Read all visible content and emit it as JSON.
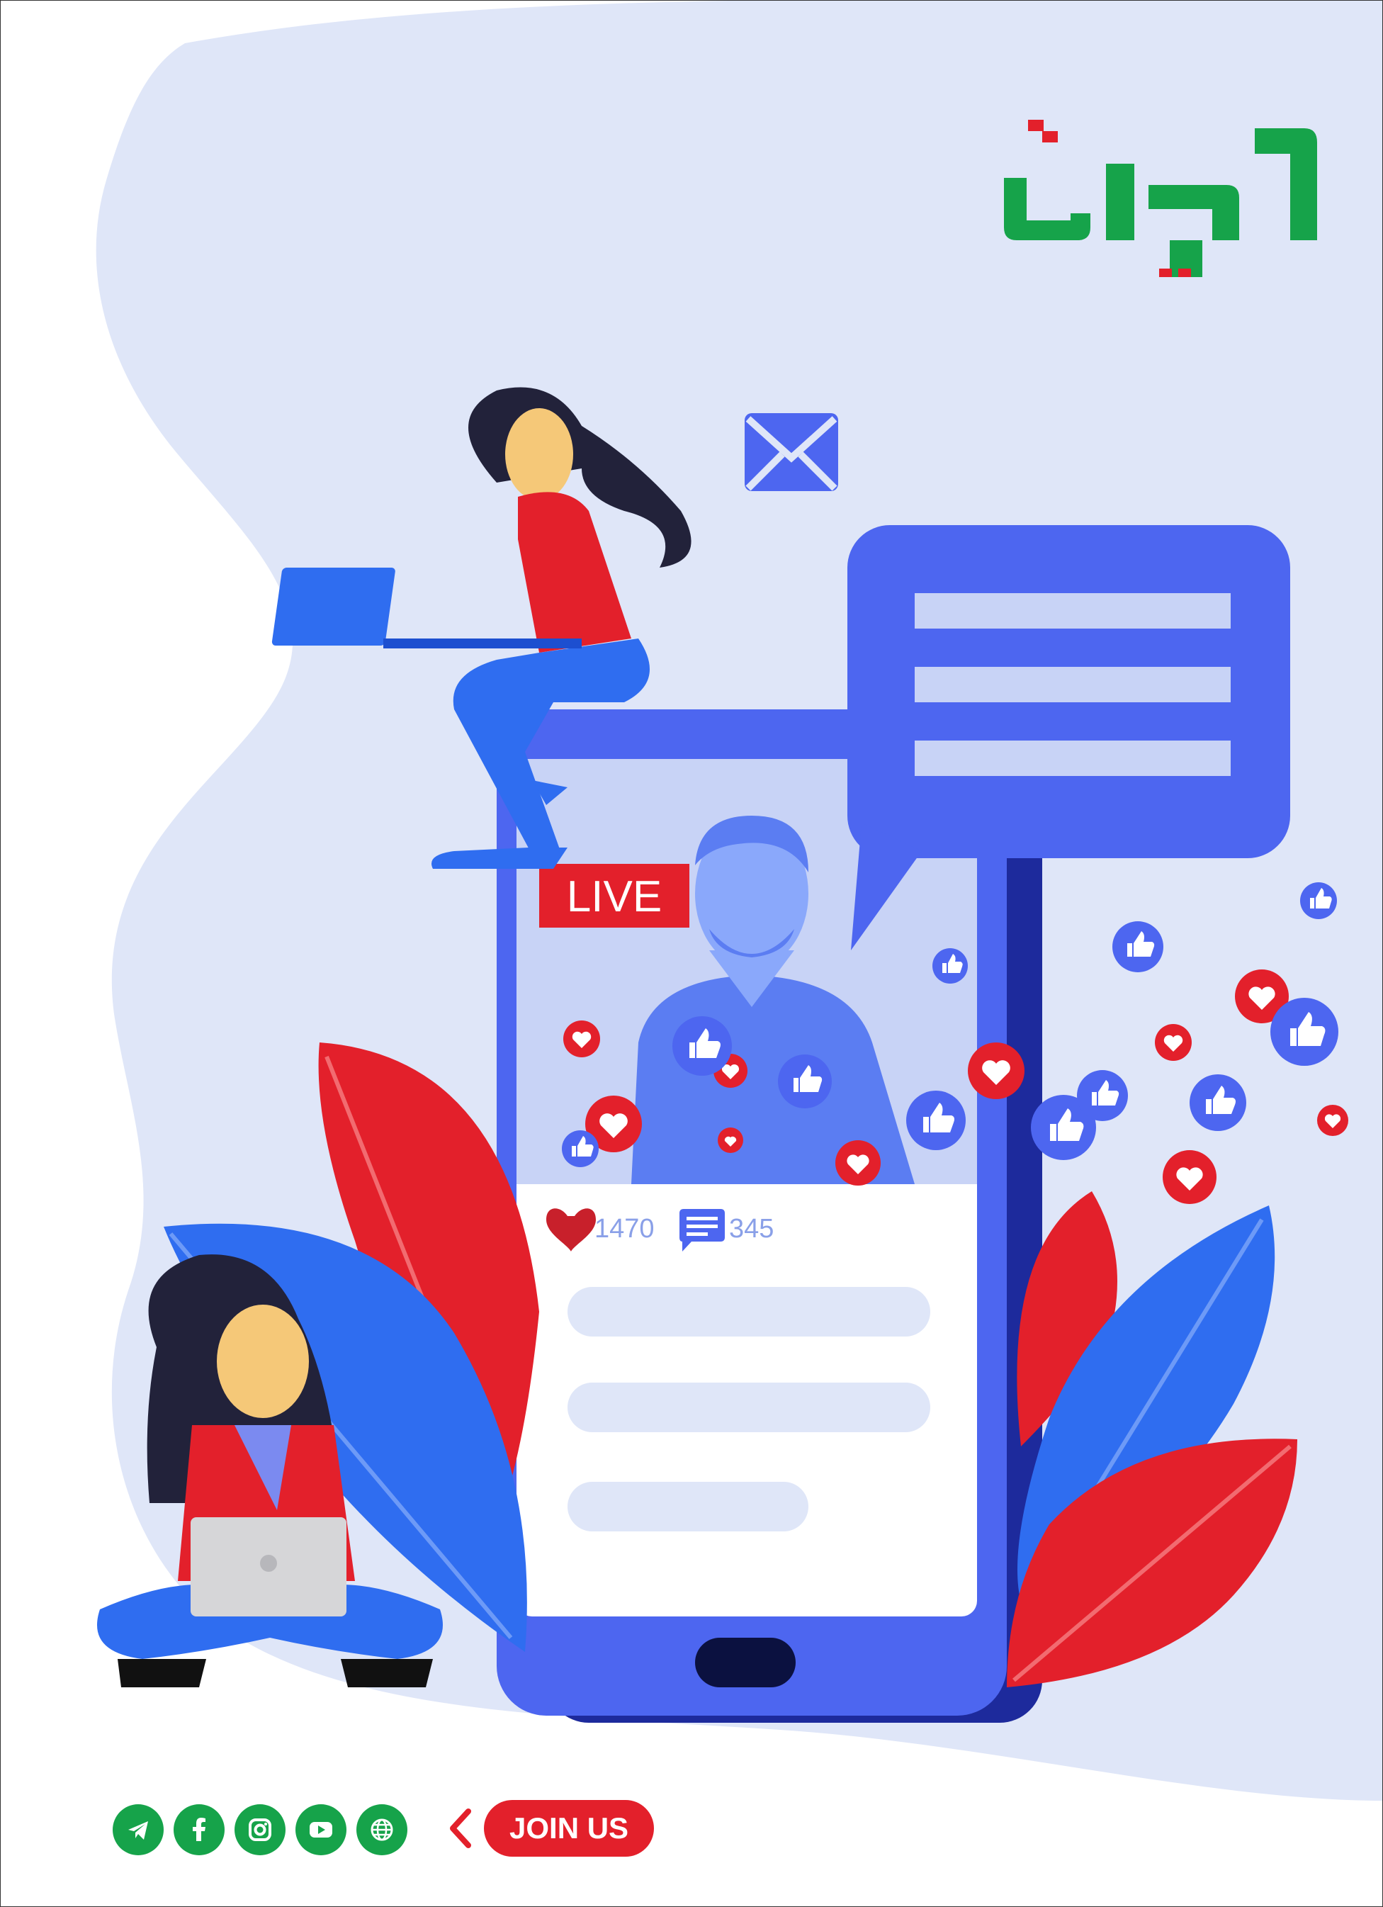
{
  "logo": {
    "text": "الحرية",
    "color": "#16a34a",
    "accent": "#e3202b"
  },
  "phone": {
    "live_label": "LIVE",
    "likes_count": "1470",
    "comments_count": "345"
  },
  "social": {
    "icons": [
      "telegram-icon",
      "facebook-icon",
      "instagram-icon",
      "youtube-icon",
      "web-icon"
    ],
    "join_label": "JOIN US"
  },
  "colors": {
    "background_blob": "#dfe6f8",
    "phone_blue": "#4d66f0",
    "phone_dark": "#1d2a9c",
    "red": "#e3202b",
    "green": "#16a34a",
    "leaf_blue": "#2f6df0"
  }
}
